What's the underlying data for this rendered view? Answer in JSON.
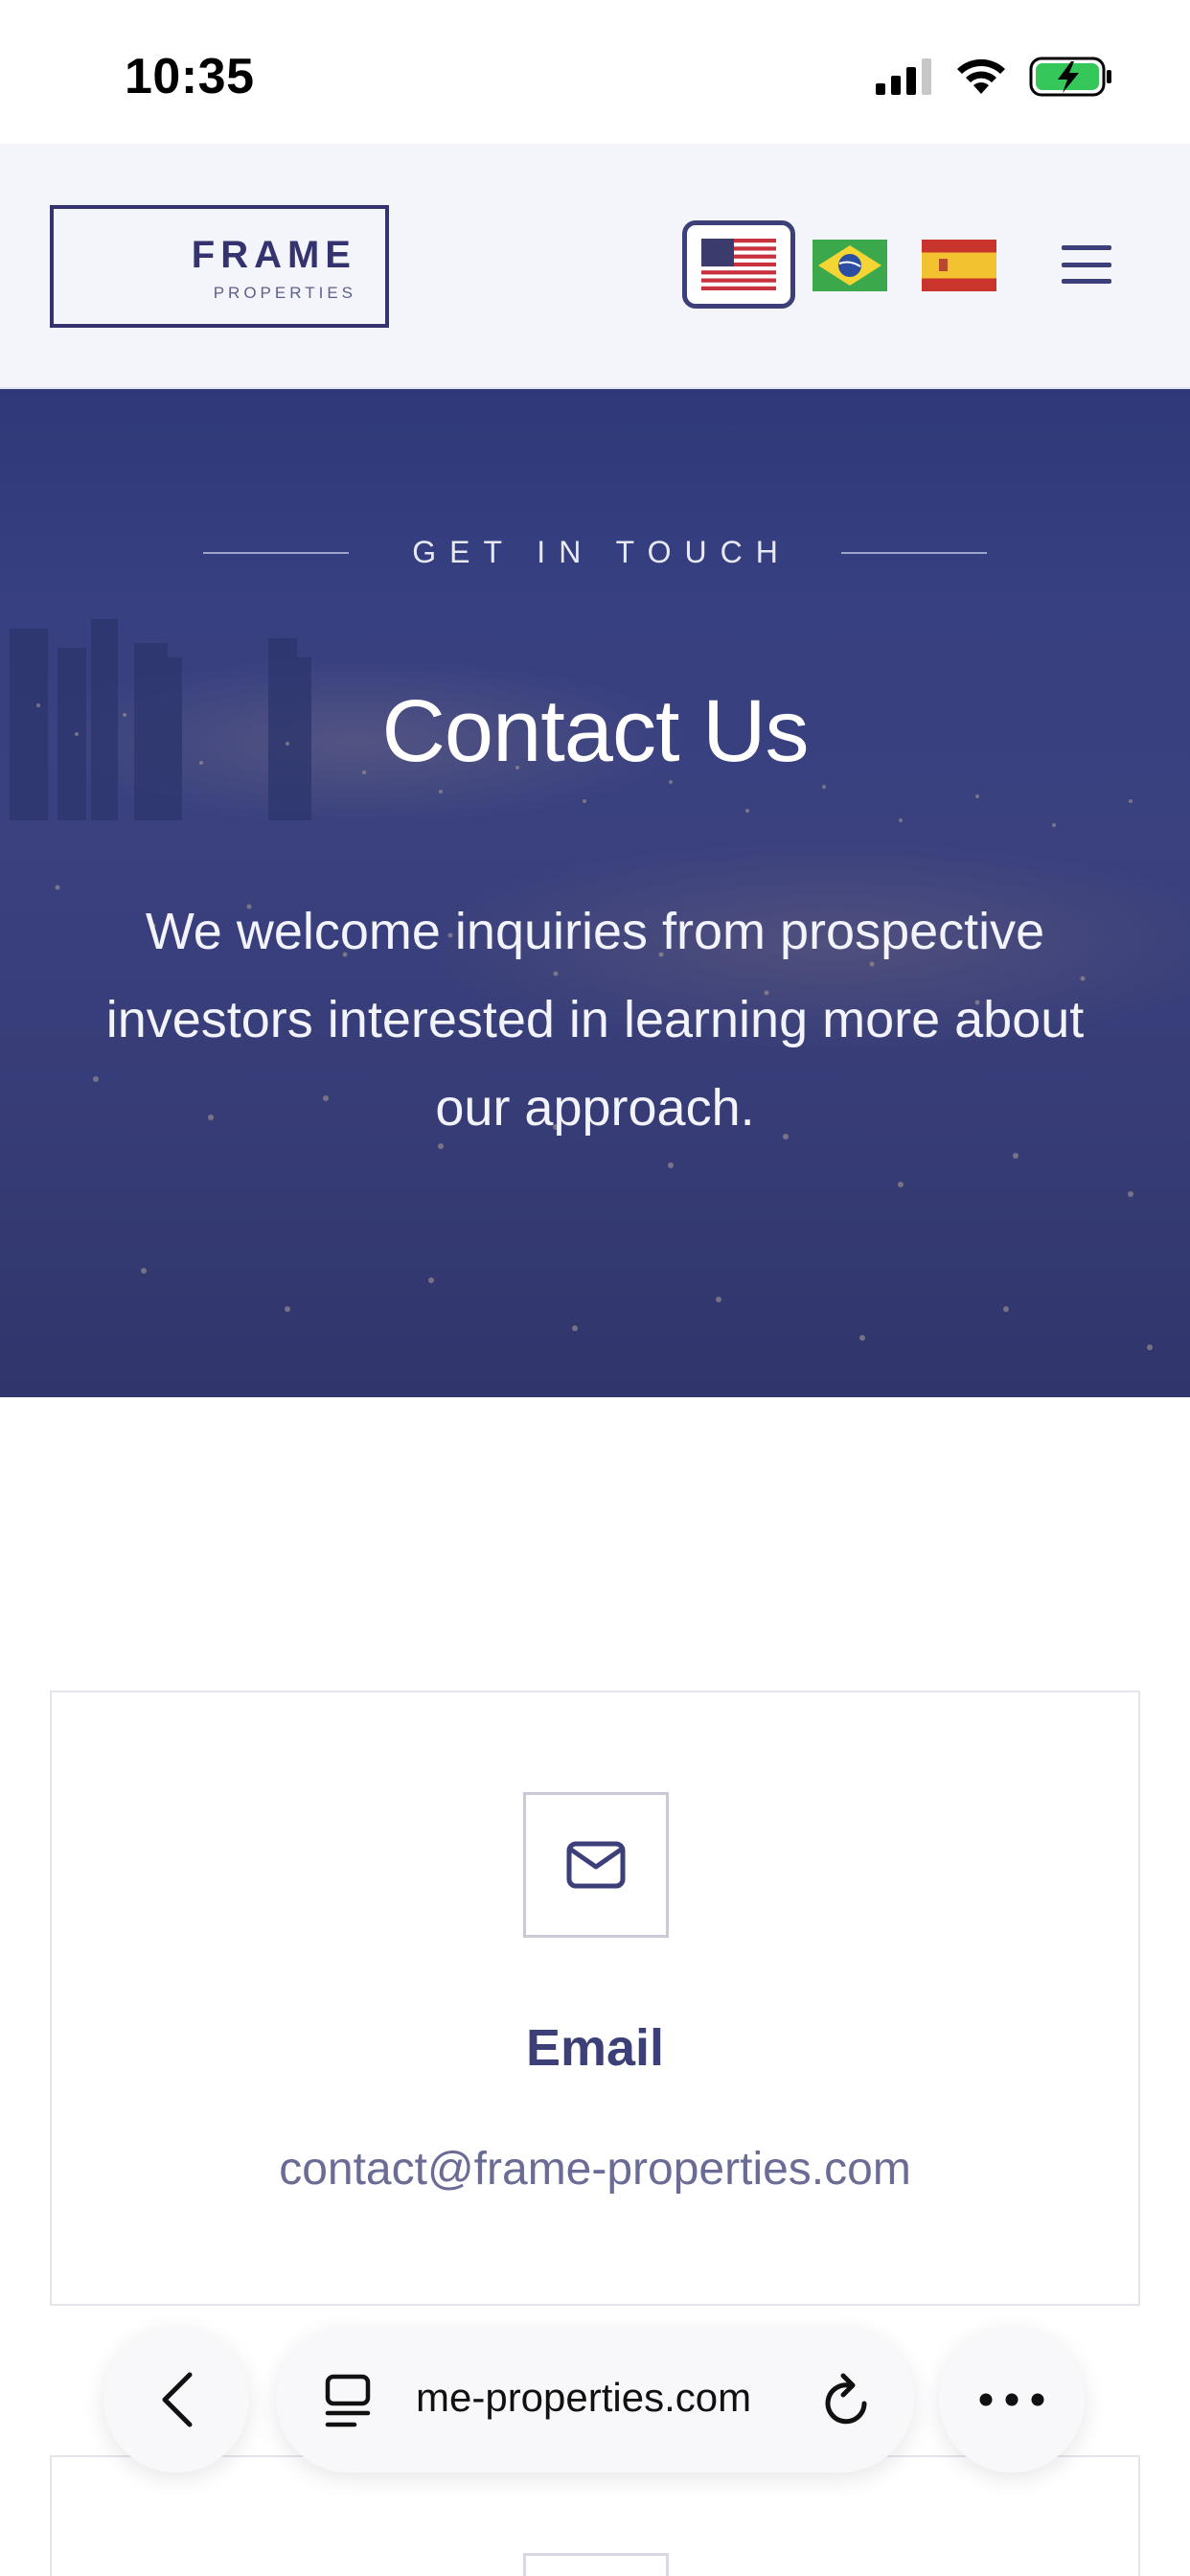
{
  "status_bar": {
    "time": "10:35"
  },
  "header": {
    "logo": {
      "main": "FRAME",
      "sub": "PROPERTIES"
    },
    "languages": [
      {
        "name": "us-flag-icon",
        "selected": true
      },
      {
        "name": "brazil-flag-icon",
        "selected": false
      },
      {
        "name": "spain-flag-icon",
        "selected": false
      }
    ],
    "menu_icon": "hamburger-menu-icon"
  },
  "hero": {
    "eyebrow": "GET IN TOUCH",
    "title": "Contact Us",
    "text": "We welcome inquiries from prospective investors interested in learning more about our approach."
  },
  "contact": {
    "email": {
      "icon": "mail-icon",
      "title": "Email",
      "value": "contact@frame-properties.com"
    }
  },
  "browser": {
    "url": "me-properties.com",
    "back_icon": "chevron-left-icon",
    "tabs_icon": "tabs-icon",
    "reload_icon": "reload-icon",
    "more_icon": "more-icon"
  },
  "colors": {
    "brand": "#3c3f78",
    "hero_overlay": "#343878",
    "muted_text": "#6a6c95"
  }
}
